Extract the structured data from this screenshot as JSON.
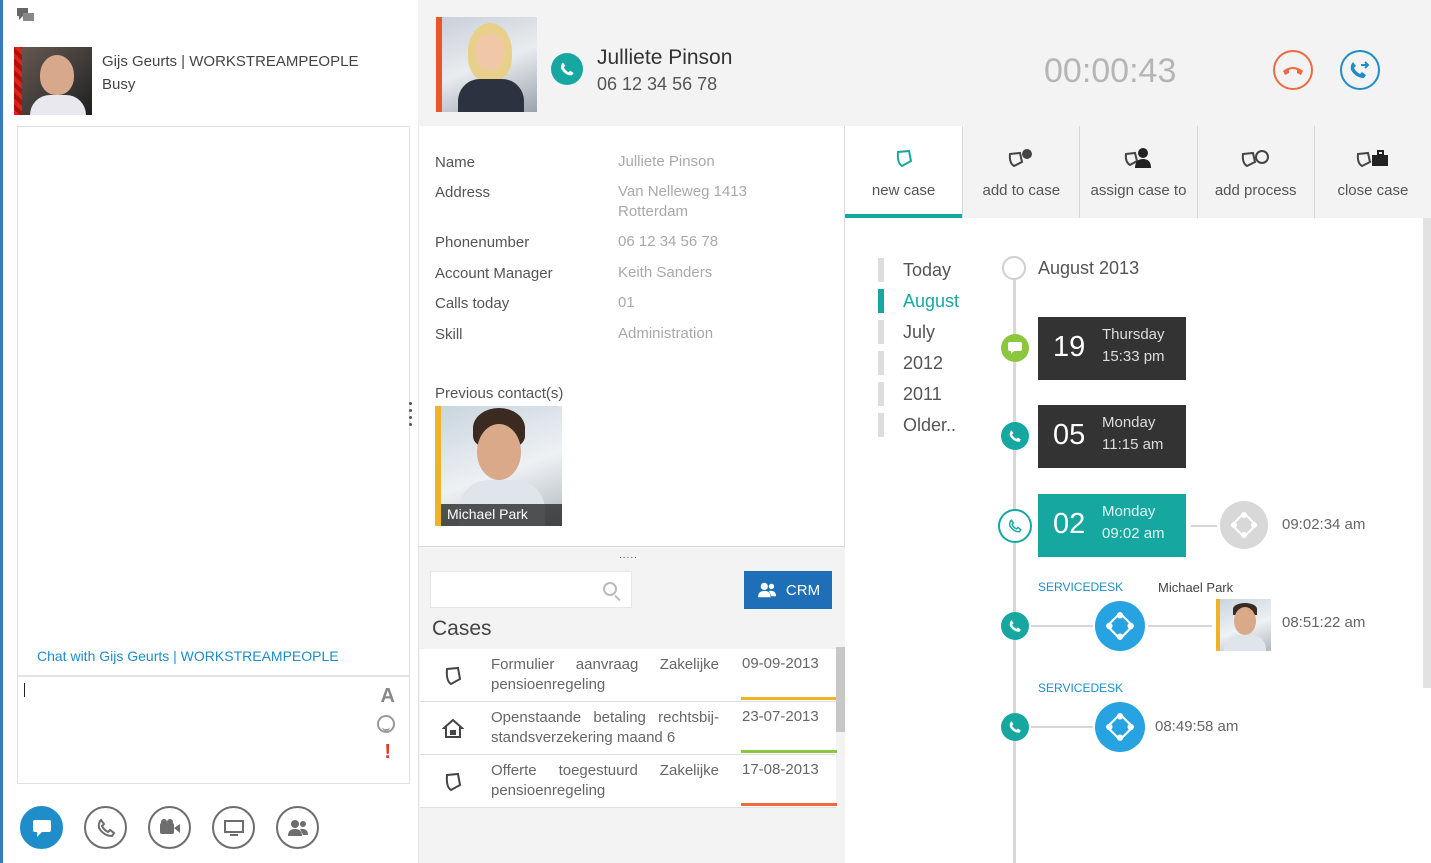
{
  "user": {
    "name": "Gijs Geurts | WORKSTREAMPEOPLE",
    "status": "Busy"
  },
  "chat": {
    "with_prefix": "Chat with",
    "with_name": "Gijs Geurts | WORKSTREAMPEOPLE",
    "format_label": "A",
    "importance_label": "!"
  },
  "bottom_bar": {
    "icons": [
      "chat-icon",
      "phone-icon",
      "video-icon",
      "screen-share-icon",
      "people-icon"
    ],
    "active": "chat-icon"
  },
  "call": {
    "caller_name": "Julliete Pinson",
    "caller_phone": "06 12 34 56 78",
    "timer": "00:00:43",
    "colors": {
      "accent": "#16a8a0",
      "hangup": "#ee6a3f",
      "transfer": "#1e8dc8"
    }
  },
  "details": {
    "fields": [
      {
        "label": "Name",
        "value": "Julliete Pinson"
      },
      {
        "label": "Address",
        "value": "Van Nelleweg 1413",
        "value2": "Rotterdam"
      },
      {
        "label": "Phonenumber",
        "value": "06 12 34 56 78"
      },
      {
        "label": "Account Manager",
        "value": "Keith Sanders"
      },
      {
        "label": "Calls today",
        "value": "01"
      },
      {
        "label": "Skill",
        "value": "Administration"
      }
    ],
    "previous_label": "Previous contact(s)",
    "previous_contact": "Michael Park"
  },
  "cases": {
    "title": "Cases",
    "search_placeholder": "",
    "crm_label": "CRM",
    "grip": ".....",
    "items": [
      {
        "title": "Formulier aanvraag Zakelijke pensioenregeling",
        "date": "09-09-2013",
        "icon": "document-hand-icon",
        "status_color": "#f0b323"
      },
      {
        "title": "Openstaande betaling rechtsbij-standsverzekering maand 6",
        "date": "23-07-2013",
        "icon": "house-icon",
        "status_color": "#8cc63f"
      },
      {
        "title": "Offerte toegestuurd Zakelijke pensioenregeling",
        "date": "17-08-2013",
        "icon": "document-hand-icon",
        "status_color": "#ee6a3f"
      }
    ]
  },
  "toolbar": {
    "buttons": [
      {
        "label": "new case",
        "icon": "new-case-icon",
        "active": true
      },
      {
        "label": "add to case",
        "icon": "add-to-case-icon",
        "active": false
      },
      {
        "label": "assign case to",
        "icon": "assign-case-icon",
        "active": false
      },
      {
        "label": "add process",
        "icon": "add-process-icon",
        "active": false
      },
      {
        "label": "close case",
        "icon": "close-case-icon",
        "active": false
      }
    ]
  },
  "timeline": {
    "filters": [
      "Today",
      "August",
      "July",
      "2012",
      "2011",
      "Older.."
    ],
    "active_filter": "August",
    "month": "August 2013",
    "events": [
      {
        "day": "19",
        "weekday": "Thursday",
        "time": "15:33 pm",
        "type": "chat",
        "highlight": false
      },
      {
        "day": "05",
        "weekday": "Monday",
        "time": "11:15 am",
        "type": "call",
        "highlight": false
      },
      {
        "day": "02",
        "weekday": "Monday",
        "time": "09:02 am",
        "type": "call",
        "highlight": true,
        "process_time": "09:02:34 am"
      }
    ],
    "servicedesk": [
      {
        "tag": "SERVICEDESK",
        "person": "Michael Park",
        "time": "08:51:22 am"
      },
      {
        "tag": "SERVICEDESK",
        "time": "08:49:58 am"
      }
    ]
  }
}
